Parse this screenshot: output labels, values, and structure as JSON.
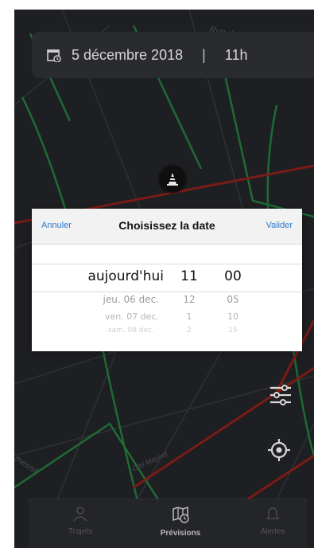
{
  "top_bar": {
    "date": "5 décembre 2018",
    "separator": "|",
    "hour": "11h"
  },
  "map_labels": {
    "street_top": "Rue du Faubourg S",
    "street_bottom": "Cité Moynet",
    "area_left": "mesnil"
  },
  "date_picker": {
    "cancel_label": "Annuler",
    "title": "Choisissez la date",
    "confirm_label": "Valider",
    "dates": [
      "aujourd'hui",
      "jeu. 06 dec.",
      "ven. 07 dec.",
      "sam. 08 dec."
    ],
    "hours": [
      "11",
      "12",
      "1",
      "2"
    ],
    "minutes": [
      "00",
      "05",
      "10",
      "15"
    ]
  },
  "tabs": [
    {
      "label": "Trajets",
      "icon": "user-icon",
      "active": false
    },
    {
      "label": "Prévisions",
      "icon": "map-clock-icon",
      "active": true
    },
    {
      "label": "Alertes",
      "icon": "bell-icon",
      "active": false
    }
  ],
  "colors": {
    "accent_blue": "#2d78c8",
    "map_bg": "#1e1f22",
    "road_red": "#7a1b16",
    "road_green": "#1f6b34"
  }
}
